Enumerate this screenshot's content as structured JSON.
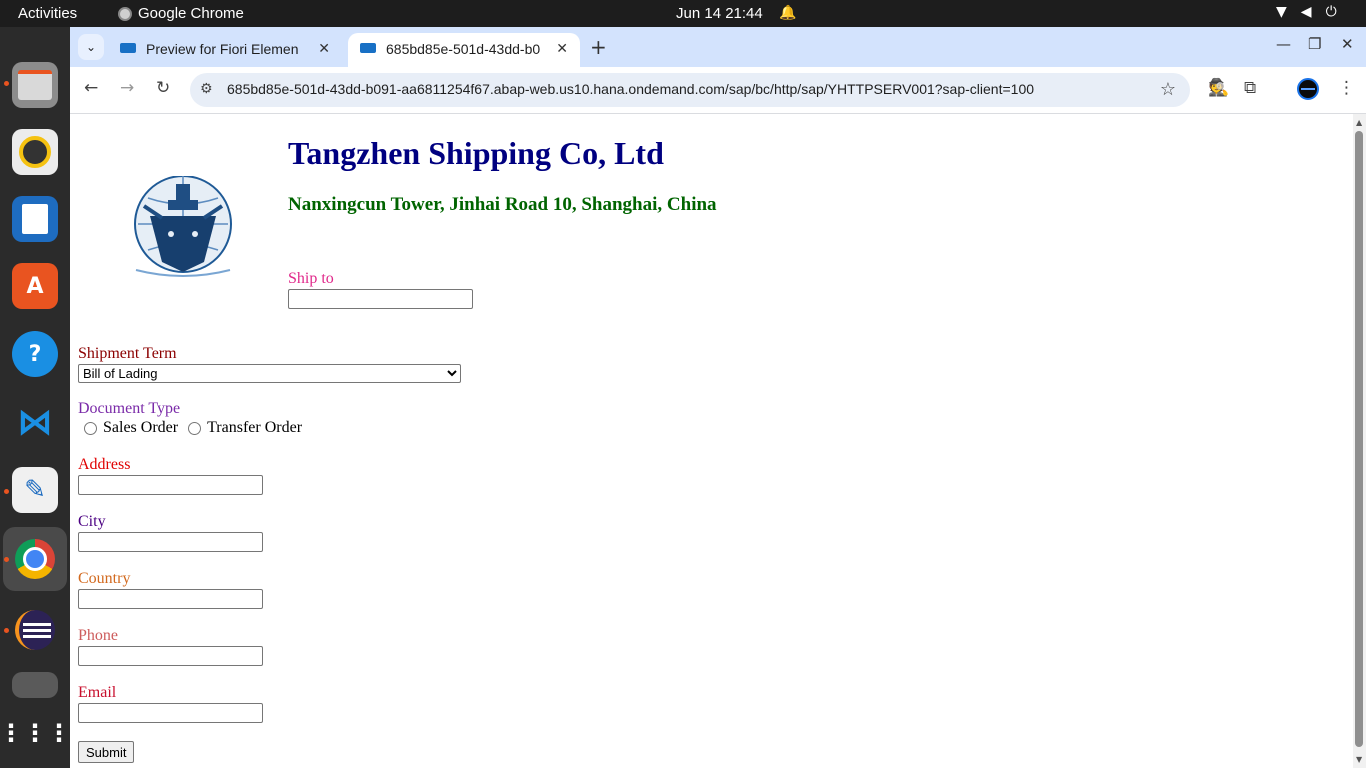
{
  "system": {
    "activities": "Activities",
    "app_name": "Google Chrome",
    "clock": "Jun 14  21:44"
  },
  "browser": {
    "tabs": [
      {
        "title": "Preview for Fiori Elemen",
        "active": false
      },
      {
        "title": "685bd85e-501d-43dd-b0",
        "active": true
      }
    ],
    "url": "685bd85e-501d-43dd-b091-aa6811254f67.abap-web.us10.hana.ondemand.com/sap/bc/http/sap/YHTTPSERV001?sap-client=100"
  },
  "page": {
    "company": "Tangzhen Shipping Co, Ltd",
    "address": "Nanxingcun Tower, Jinhai Road 10, Shanghai, China",
    "ship_to": {
      "label": "Ship to",
      "value": ""
    },
    "shipment_term": {
      "label": "Shipment Term",
      "selected": "Bill of Lading"
    },
    "document_type": {
      "label": "Document Type",
      "options": [
        "Sales Order",
        "Transfer Order"
      ]
    },
    "fields": {
      "address": {
        "label": "Address",
        "value": ""
      },
      "city": {
        "label": "City",
        "value": ""
      },
      "country": {
        "label": "Country",
        "value": ""
      },
      "phone": {
        "label": "Phone",
        "value": ""
      },
      "email": {
        "label": "Email",
        "value": ""
      }
    },
    "submit_label": "Submit",
    "colors": {
      "company": "#000080",
      "address": "#006400",
      "ship_to": "#e0288a",
      "shipment_term": "#8b0000",
      "document_type": "#7a2aa8",
      "address_label": "#e00000",
      "city": "#4b0082",
      "country": "#d2691e",
      "phone": "#cd5c5c",
      "email": "#c8102e"
    }
  }
}
